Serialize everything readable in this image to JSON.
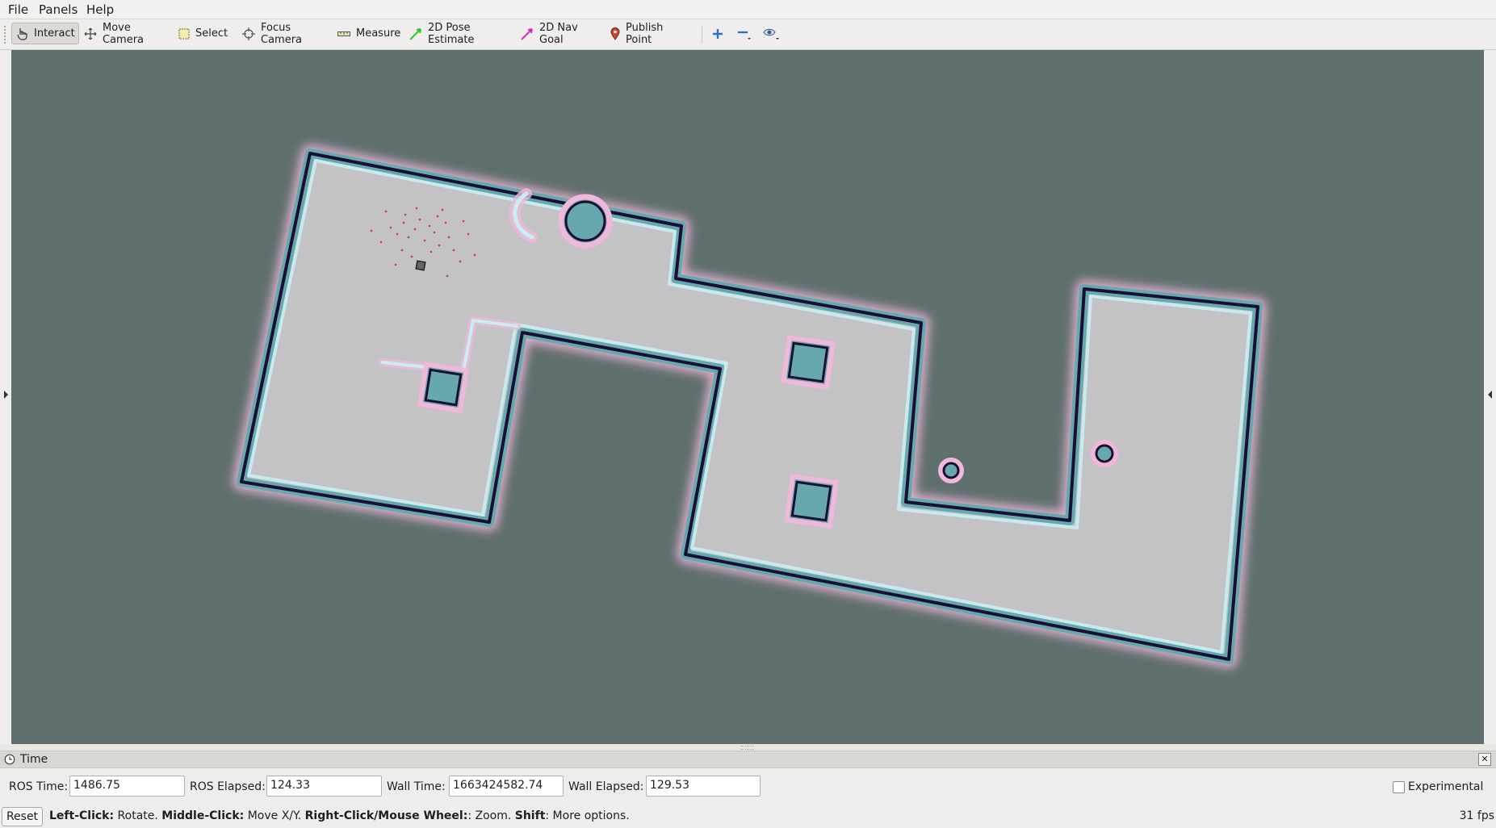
{
  "menu": {
    "file": "File",
    "panels": "Panels",
    "help": "Help"
  },
  "toolbar": {
    "interact": "Interact",
    "move_camera": "Move Camera",
    "select": "Select",
    "focus_camera": "Focus Camera",
    "measure": "Measure",
    "pose_estimate": "2D Pose Estimate",
    "nav_goal": "2D Nav Goal",
    "publish_point": "Publish Point"
  },
  "time_panel": {
    "title": "Time",
    "ros_time_label": "ROS Time:",
    "ros_time_value": "1486.75",
    "ros_elapsed_label": "ROS Elapsed:",
    "ros_elapsed_value": "124.33",
    "wall_time_label": "Wall Time:",
    "wall_time_value": "1663424582.74",
    "wall_elapsed_label": "Wall Elapsed:",
    "wall_elapsed_value": "129.53",
    "experimental_label": "Experimental"
  },
  "status": {
    "reset": "Reset",
    "left_click": "Left-Click:",
    "left_click_desc": " Rotate. ",
    "middle_click": "Middle-Click:",
    "middle_click_desc": " Move X/Y. ",
    "right_click": "Right-Click/Mouse Wheel:",
    "right_click_desc": ": Zoom. ",
    "shift": "Shift",
    "shift_desc": ": More options.",
    "fps": "31 fps"
  },
  "colors": {
    "viewport_bg": "#5f6f6e",
    "map_free": "#c3c3c5",
    "map_wall": "#1a0f33",
    "costmap_inflation": "#66a8ad",
    "costmap_halo": "#f0b8d8"
  }
}
